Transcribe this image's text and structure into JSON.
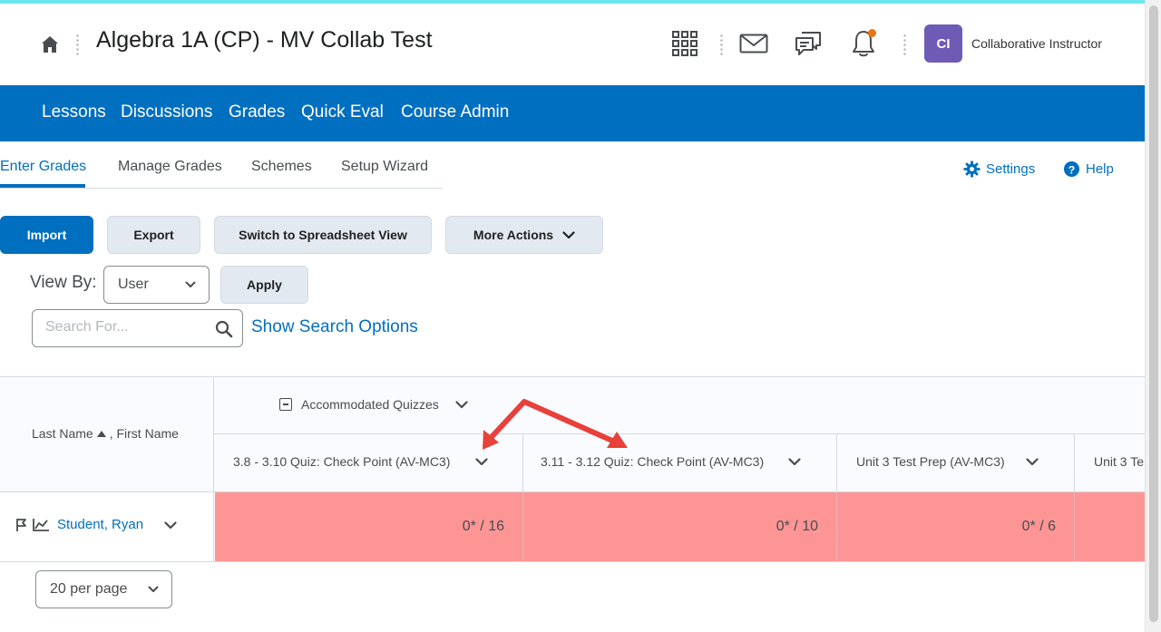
{
  "header": {
    "course_title": "Algebra 1A (CP) - MV Collab Test",
    "user_initials": "CI",
    "user_name": "Collaborative Instructor"
  },
  "nav": {
    "items": [
      "Lessons",
      "Discussions",
      "Grades",
      "Quick Eval",
      "Course Admin"
    ]
  },
  "tabs": {
    "items": [
      "Enter Grades",
      "Manage Grades",
      "Schemes",
      "Setup Wizard"
    ],
    "active": "Enter Grades",
    "settings_label": "Settings",
    "help_label": "Help"
  },
  "actions": {
    "import": "Import",
    "export": "Export",
    "switch_view": "Switch to Spreadsheet View",
    "more_actions": "More Actions"
  },
  "view_by": {
    "label": "View By:",
    "selected": "User",
    "apply": "Apply"
  },
  "search": {
    "placeholder": "Search For...",
    "show_options": "Show Search Options"
  },
  "grid": {
    "name_header": "Last Name",
    "name_header_suffix": ", First Name",
    "category": "Accommodated Quizzes",
    "columns": [
      "3.8 - 3.10 Quiz: Check Point (AV-MC3)",
      "3.11 - 3.12 Quiz: Check Point (AV-MC3)",
      "Unit 3 Test Prep (AV-MC3)",
      "Unit 3 Te"
    ],
    "rows": [
      {
        "student": "Student, Ryan",
        "grades": [
          "0* / 16",
          "0* / 10",
          "0* / 6",
          ""
        ]
      }
    ]
  },
  "pagination": {
    "per_page": "20 per page"
  },
  "colors": {
    "brand_blue": "#006fbf",
    "failing_cell": "#fe9595",
    "annotation_arrow": "#e8403a",
    "avatar": "#6e5bb5",
    "notification_dot": "#e87511"
  }
}
